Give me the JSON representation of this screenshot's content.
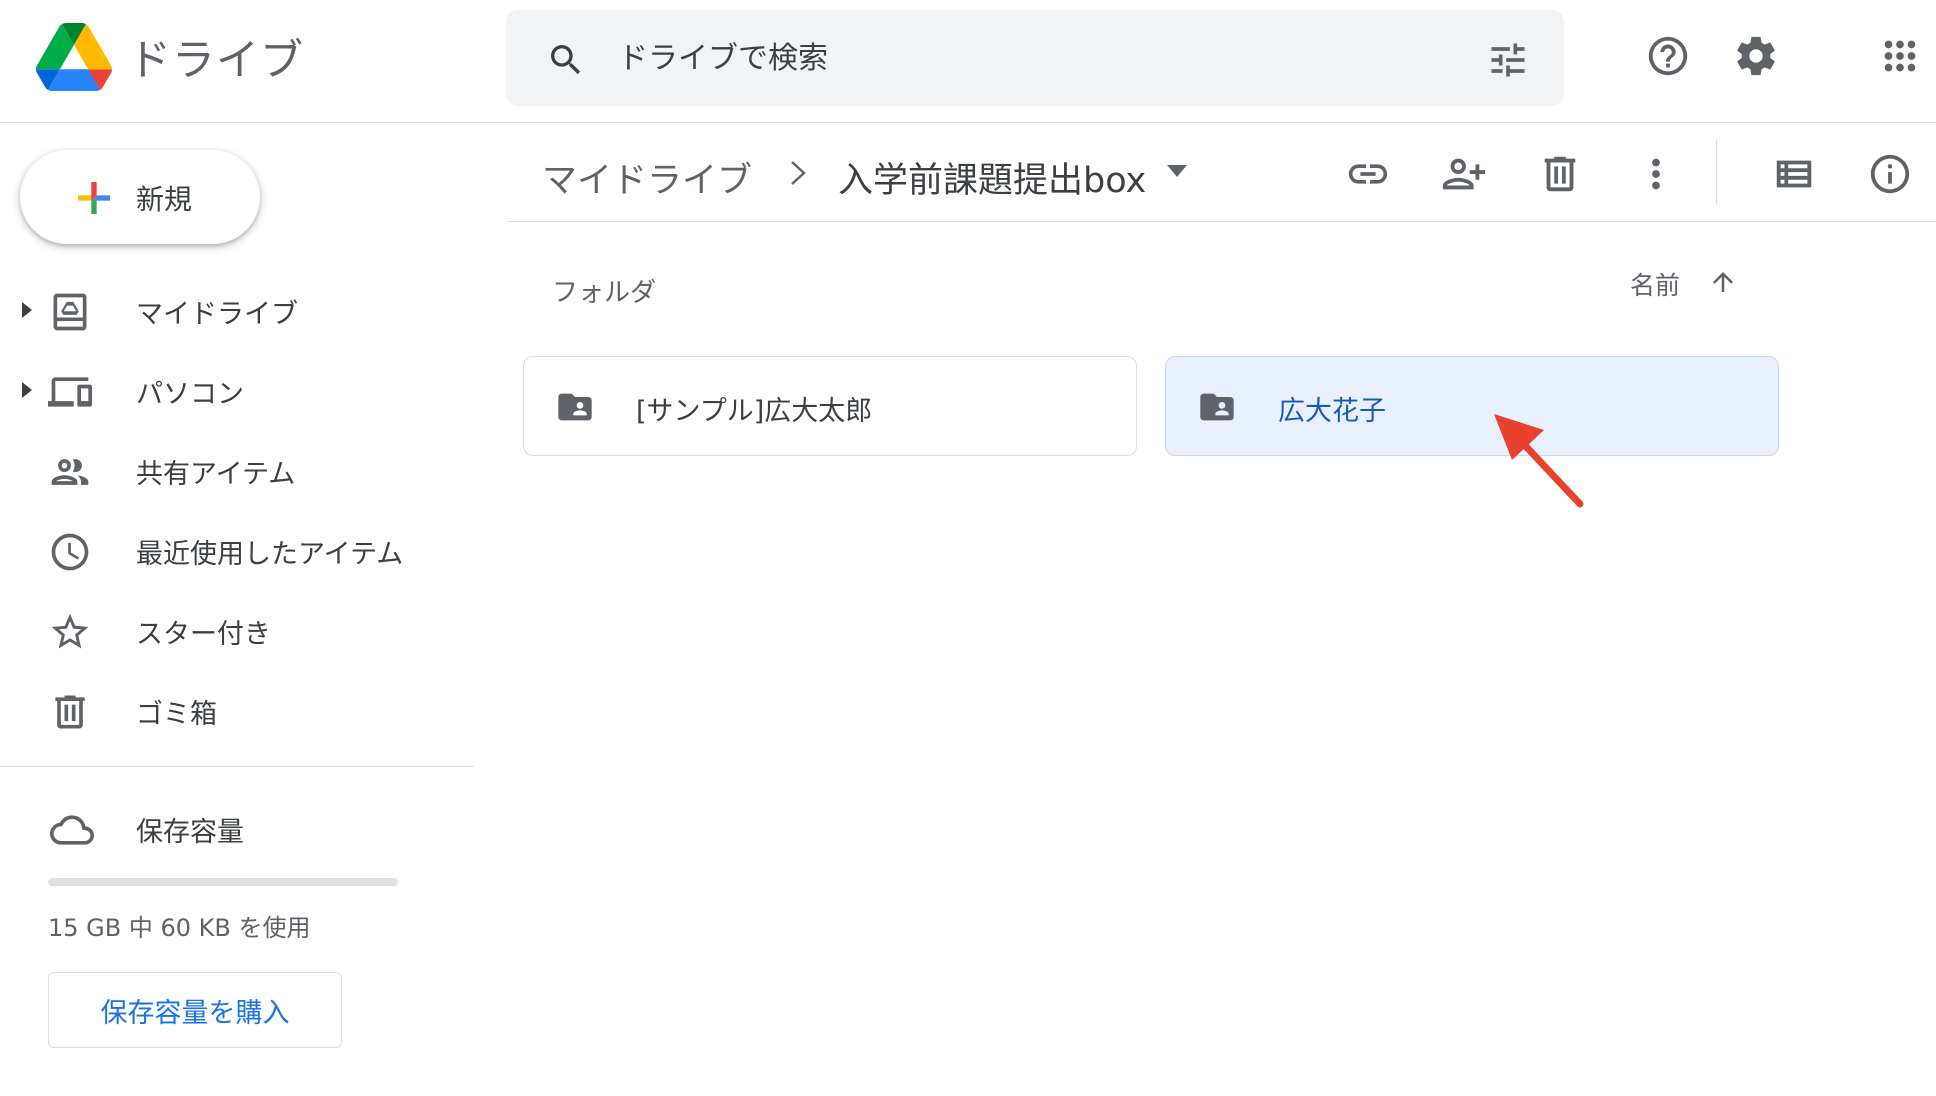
{
  "app": {
    "logo_text": "ドライブ"
  },
  "search": {
    "placeholder": "ドライブで検索"
  },
  "sidebar": {
    "new_label": "新規",
    "items": [
      {
        "label": "マイドライブ"
      },
      {
        "label": "パソコン"
      },
      {
        "label": "共有アイテム"
      },
      {
        "label": "最近使用したアイテム"
      },
      {
        "label": "スター付き"
      },
      {
        "label": "ゴミ箱"
      }
    ],
    "storage": {
      "label": "保存容量",
      "used_fraction": 4e-06,
      "usage_text": "15 GB 中 60 KB を使用",
      "buy_label": "保存容量を購入"
    }
  },
  "breadcrumb": {
    "root": "マイドライブ",
    "current": "入学前課題提出box"
  },
  "content": {
    "section_label": "フォルダ",
    "sort_label": "名前",
    "folders": [
      {
        "name": "[サンプル]広大太郎",
        "selected": false
      },
      {
        "name": "広大花子",
        "selected": true
      }
    ]
  },
  "colors": {
    "accent": "#1a73e8",
    "selected_bg": "#e8f0fe",
    "selected_text": "#185abc",
    "annotation_arrow": "#e8412c"
  }
}
